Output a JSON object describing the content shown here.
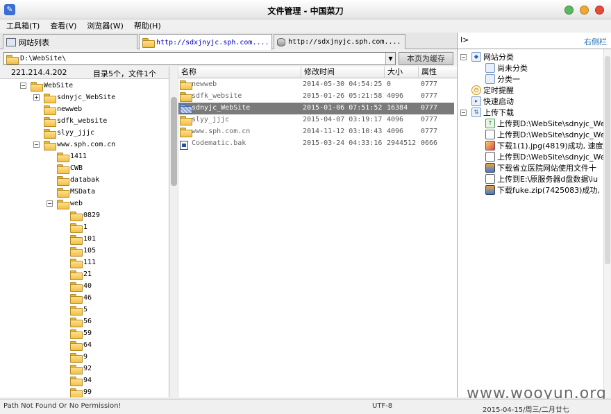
{
  "window": {
    "title": "文件管理 - 中国菜刀"
  },
  "menu": [
    {
      "label": "工具箱(T)"
    },
    {
      "label": "查看(V)"
    },
    {
      "label": "浏览器(W)"
    },
    {
      "label": "帮助(H)"
    }
  ],
  "tabs": [
    {
      "label": "网站列表"
    },
    {
      "label": "http://sdxjnyjc.sph.com...."
    },
    {
      "label": "http://sdxjnyjc.sph.com...."
    }
  ],
  "toolbar": {
    "path": "D:\\WebSite\\",
    "cache_button": "本页为缓存"
  },
  "info": {
    "ip": "221.214.4.202",
    "count": "目录5个，文件1个"
  },
  "tree": {
    "items": [
      {
        "label": "WebSite",
        "toggle": "−"
      },
      {
        "label": "sdnyjc_WebSite",
        "toggle": "+"
      },
      {
        "label": "newweb",
        "toggle": ""
      },
      {
        "label": "sdfk_website",
        "toggle": ""
      },
      {
        "label": "slyy_jjjc",
        "toggle": ""
      },
      {
        "label": "www.sph.com.cn",
        "toggle": "−"
      },
      {
        "label": "1411",
        "toggle": ""
      },
      {
        "label": "CWB",
        "toggle": ""
      },
      {
        "label": "databak",
        "toggle": ""
      },
      {
        "label": "MSData",
        "toggle": ""
      },
      {
        "label": "web",
        "toggle": "−"
      },
      {
        "label": "0829",
        "toggle": ""
      },
      {
        "label": "1",
        "toggle": ""
      },
      {
        "label": "101",
        "toggle": ""
      },
      {
        "label": "105",
        "toggle": ""
      },
      {
        "label": "111",
        "toggle": ""
      },
      {
        "label": "21",
        "toggle": ""
      },
      {
        "label": "40",
        "toggle": ""
      },
      {
        "label": "46",
        "toggle": ""
      },
      {
        "label": "5",
        "toggle": ""
      },
      {
        "label": "56",
        "toggle": ""
      },
      {
        "label": "59",
        "toggle": ""
      },
      {
        "label": "64",
        "toggle": ""
      },
      {
        "label": "9",
        "toggle": ""
      },
      {
        "label": "92",
        "toggle": ""
      },
      {
        "label": "94",
        "toggle": ""
      },
      {
        "label": "99",
        "toggle": ""
      }
    ]
  },
  "files": {
    "headers": {
      "name": "名称",
      "time": "修改时间",
      "size": "大小",
      "attr": "属性"
    },
    "rows": [
      {
        "name": "newweb",
        "time": "2014-05-30 04:54:25",
        "size": "0",
        "attr": "0777",
        "icon": "folder-icon"
      },
      {
        "name": "sdfk_website",
        "time": "2015-01-26 05:21:58",
        "size": "4096",
        "attr": "0777",
        "icon": "folder-icon"
      },
      {
        "name": "sdnyjc_WebSite",
        "time": "2015-01-06 07:51:52",
        "size": "16384",
        "attr": "0777",
        "icon": "folder-icon"
      },
      {
        "name": "slyy_jjjc",
        "time": "2015-04-07 03:19:17",
        "size": "4096",
        "attr": "0777",
        "icon": "folder-icon"
      },
      {
        "name": "www.sph.com.cn",
        "time": "2014-11-12 03:10:43",
        "size": "4096",
        "attr": "0777",
        "icon": "folder-icon"
      },
      {
        "name": "Codematic.bak",
        "time": "2015-03-24 04:33:16",
        "size": "2944512",
        "attr": "0666",
        "icon": "bak-file-icon"
      }
    ]
  },
  "sidebar": {
    "arrow": "I>",
    "title": "右侧栏",
    "items": [
      {
        "label": "网站分类",
        "toggle": "−",
        "icon": "category-icon"
      },
      {
        "label": "尚未分类",
        "toggle": "",
        "icon": "category-item-icon"
      },
      {
        "label": "分类一",
        "toggle": "",
        "icon": "category-item-icon"
      },
      {
        "label": "定时提醒",
        "toggle": "",
        "icon": "clock-icon"
      },
      {
        "label": "快速启动",
        "toggle": "",
        "icon": "launch-icon"
      },
      {
        "label": "上传下载",
        "toggle": "−",
        "icon": "transfer-icon"
      },
      {
        "label": "上传到D:\\WebSite\\sdnyjc_WebSite",
        "toggle": "",
        "icon": "upload-icon"
      },
      {
        "label": "上传到D:\\WebSite\\sdnyjc_WebSite",
        "toggle": "",
        "icon": "upload-doc-icon"
      },
      {
        "label": "下载1(1).jpg(4819)成功, 速度",
        "toggle": "",
        "icon": "image-icon"
      },
      {
        "label": "上传到D:\\WebSite\\sdnyjc_WebSite",
        "toggle": "",
        "icon": "upload-doc-icon"
      },
      {
        "label": "下载省立医院网站使用文件十",
        "toggle": "",
        "icon": "download-icon"
      },
      {
        "label": "上传到E:\\原服务器d盘数据\\iu",
        "toggle": "",
        "icon": "upload-doc-icon"
      },
      {
        "label": "下载fuke.zip(7425083)成功,",
        "toggle": "",
        "icon": "download-icon"
      }
    ]
  },
  "status": {
    "message": "Path Not Found Or No Permission!",
    "encoding": "UTF-8",
    "date": "2015-04-15/周三/二月廿七"
  },
  "watermark": "www.wooyun.org",
  "colors": {
    "selected_row": "#7a7a7a",
    "link": "#1a6bb0",
    "close": "#e8493a",
    "minimize": "#f0a830",
    "maximize": "#5cb85c"
  }
}
